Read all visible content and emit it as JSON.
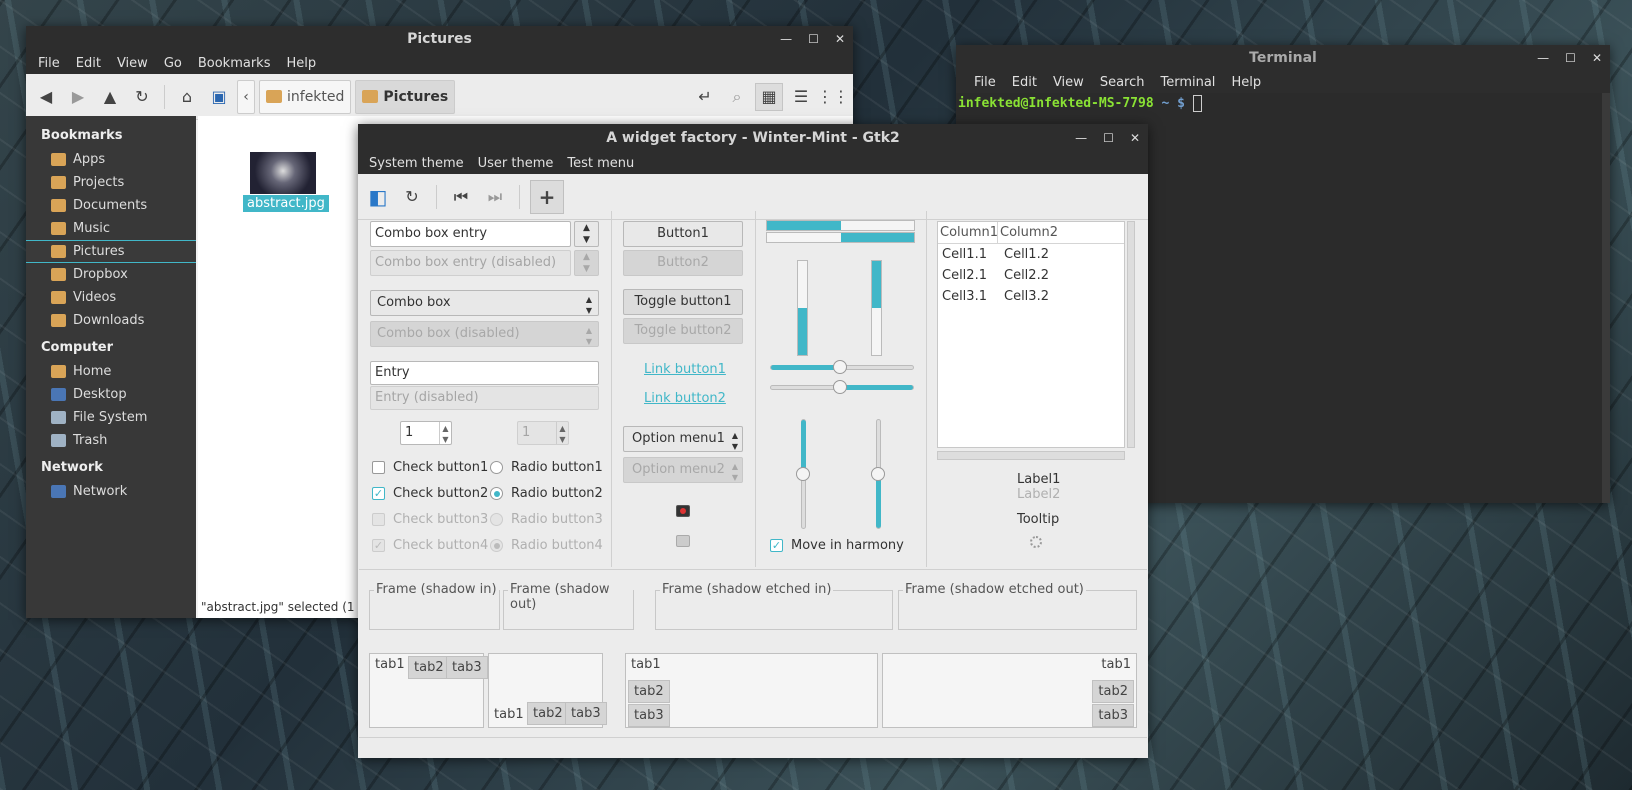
{
  "nemo": {
    "title": "Pictures",
    "menu": [
      "File",
      "Edit",
      "View",
      "Go",
      "Bookmarks",
      "Help"
    ],
    "crumbs": [
      "infekted",
      "Pictures"
    ],
    "sidebar": {
      "bookmarks_header": "Bookmarks",
      "bookmarks": [
        "Apps",
        "Projects",
        "Documents",
        "Music",
        "Pictures",
        "Dropbox",
        "Videos",
        "Downloads"
      ],
      "computer_header": "Computer",
      "computer": [
        "Home",
        "Desktop",
        "File System",
        "Trash"
      ],
      "network_header": "Network",
      "network": [
        "Network"
      ]
    },
    "file": "abstract.jpg",
    "status": "\"abstract.jpg\" selected (1"
  },
  "terminal": {
    "title": "Terminal",
    "menu": [
      "File",
      "Edit",
      "View",
      "Search",
      "Terminal",
      "Help"
    ],
    "prompt_user": "infekted@Infekted-MS-7798",
    "prompt_dir": "~ $"
  },
  "factory": {
    "title": "A widget factory - Winter-Mint - Gtk2",
    "menu": [
      "System theme",
      "User theme",
      "Test menu"
    ],
    "combo_entry": "Combo box entry",
    "combo_entry_dis": "Combo box entry (disabled)",
    "combo": "Combo box",
    "combo_dis": "Combo box (disabled)",
    "entry": "Entry",
    "entry_dis": "Entry (disabled)",
    "spin1": "1",
    "spin2": "1",
    "check1": "Check button1",
    "check2": "Check button2",
    "check3": "Check button3",
    "check4": "Check button4",
    "radio1": "Radio button1",
    "radio2": "Radio button2",
    "radio3": "Radio button3",
    "radio4": "Radio button4",
    "button1": "Button1",
    "button2": "Button2",
    "toggle1": "Toggle button1",
    "toggle2": "Toggle button2",
    "link1": "Link button1",
    "link2": "Link button2",
    "option1": "Option menu1",
    "option2": "Option menu2",
    "harmony": "Move in harmony",
    "tree_cols": [
      "Column1",
      "Column2"
    ],
    "tree_rows": [
      [
        "Cell1.1",
        "Cell1.2"
      ],
      [
        "Cell2.1",
        "Cell2.2"
      ],
      [
        "Cell3.1",
        "Cell3.2"
      ]
    ],
    "label1": "Label1",
    "label2": "Label2",
    "tooltip": "Tooltip",
    "frames": [
      "Frame (shadow in)",
      "Frame (shadow out)",
      "Frame (shadow etched in)",
      "Frame (shadow etched out)"
    ],
    "tabs": [
      "tab1",
      "tab2",
      "tab3"
    ],
    "progress_h": [
      0.5,
      0.5
    ],
    "progress_v": [
      0.5,
      0.5
    ],
    "colors": {
      "accent": "#41b7c8"
    }
  }
}
